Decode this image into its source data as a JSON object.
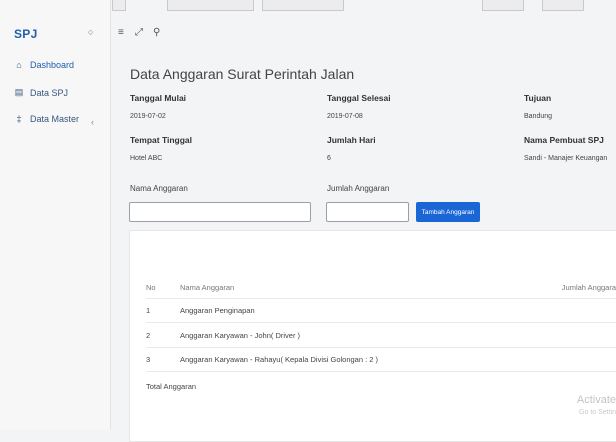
{
  "sidebar": {
    "brand": "SPJ",
    "toggle_icon": "circle-toggle-icon",
    "items": [
      {
        "label": "Dashboard",
        "icon": "home-icon",
        "glyph": "⌂"
      },
      {
        "label": "Data SPJ",
        "icon": "document-icon",
        "glyph": "▤"
      },
      {
        "label": "Data Master",
        "icon": "pin-icon",
        "glyph": "‡"
      }
    ],
    "chevron": "‹"
  },
  "topbar": {
    "menu_glyph": "≡",
    "expand_glyph": "⤢",
    "search_glyph": "⚲"
  },
  "page": {
    "title": "Data Anggaran Surat Perintah Jalan",
    "fields": {
      "tanggal_mulai_label": "Tanggal Mulai",
      "tanggal_mulai": "2019-07-02",
      "tanggal_selesai_label": "Tanggal Selesai",
      "tanggal_selesai": "2019-07-08",
      "tujuan_label": "Tujuan",
      "tujuan": "Bandung",
      "tempat_tinggal_label": "Tempat Tinggal",
      "tempat_tinggal": "Hotel ABC",
      "jumlah_hari_label": "Jumlah Hari",
      "jumlah_hari": "6",
      "pembuat_label": "Nama Pembuat SPJ",
      "pembuat": "Sandi - Manajer Keuangan"
    },
    "form": {
      "nama_label": "Nama Anggaran",
      "nama_value": "",
      "jumlah_label": "Jumlah Anggaran",
      "jumlah_value": "",
      "submit": "Tambah Anggaran"
    },
    "table": {
      "headers": [
        "No",
        "Nama Anggaran",
        "Jumlah Anggara"
      ],
      "rows": [
        {
          "no": "1",
          "nama": "Anggaran Penginapan"
        },
        {
          "no": "2",
          "nama": "Anggaran Karyawan - John( Driver )"
        },
        {
          "no": "3",
          "nama": "Anggaran Karyawan - Rahayu( Kepala Divisi Golongan : 2 )"
        }
      ],
      "total_label": "Total Anggaran"
    }
  },
  "watermark": {
    "line1": "Activate",
    "line2": "Go to Settin"
  }
}
